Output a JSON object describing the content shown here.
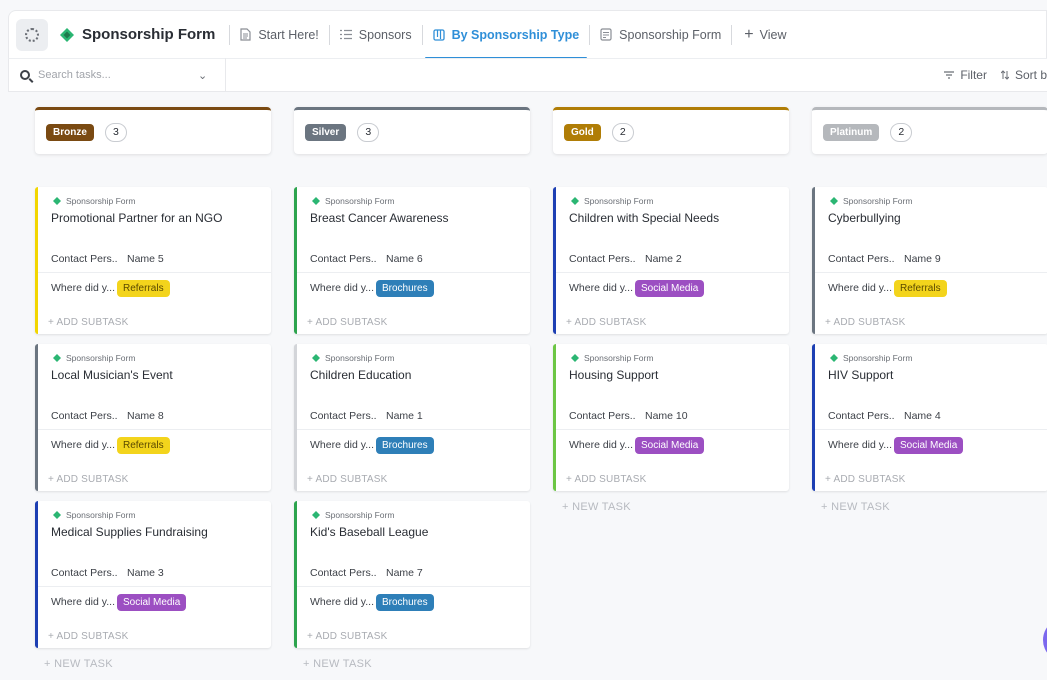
{
  "header": {
    "list_title": "Sponsorship Form",
    "tabs": [
      {
        "label": "Start Here!",
        "icon": "doc-icon"
      },
      {
        "label": "Sponsors",
        "icon": "list-icon"
      },
      {
        "label": "By Sponsorship Type",
        "icon": "board-icon",
        "active": true
      },
      {
        "label": "Sponsorship Form",
        "icon": "form-icon"
      }
    ],
    "add_view_label": "View"
  },
  "toolbar": {
    "search_placeholder": "Search tasks...",
    "filter_label": "Filter",
    "sort_label": "Sort b"
  },
  "colors": {
    "accent": "#2f8fd8",
    "bronze": "#7a4a12",
    "silver": "#6b7580",
    "gold": "#b07d06",
    "platinum": "#b5b8bc",
    "referrals_tag": "#f3d41c",
    "brochures_tag": "#2e7fb8",
    "social_media_tag": "#9c4fc2"
  },
  "board": {
    "card_source": "Sponsorship Form",
    "contact_label": "Contact Pers...",
    "where_label": "Where did y...",
    "add_subtask_label": "+ ADD SUBTASK",
    "new_task_label": "+ NEW TASK",
    "columns": [
      {
        "name": "Bronze",
        "count": "3",
        "cards": [
          {
            "title": "Promotional Partner for an NGO",
            "contact": "Name 5",
            "source": "Referrals"
          },
          {
            "title": "Local Musician's Event",
            "contact": "Name 8",
            "source": "Referrals"
          },
          {
            "title": "Medical Supplies Fundraising",
            "contact": "Name 3",
            "source": "Social Media"
          }
        ]
      },
      {
        "name": "Silver",
        "count": "3",
        "cards": [
          {
            "title": "Breast Cancer Awareness",
            "contact": "Name 6",
            "source": "Brochures"
          },
          {
            "title": "Children Education",
            "contact": "Name 1",
            "source": "Brochures"
          },
          {
            "title": "Kid's Baseball League",
            "contact": "Name 7",
            "source": "Brochures"
          }
        ]
      },
      {
        "name": "Gold",
        "count": "2",
        "cards": [
          {
            "title": "Children with Special Needs",
            "contact": "Name 2",
            "source": "Social Media"
          },
          {
            "title": "Housing Support",
            "contact": "Name 10",
            "source": "Social Media"
          }
        ]
      },
      {
        "name": "Platinum",
        "count": "2",
        "cards": [
          {
            "title": "Cyberbullying",
            "contact": "Name 9",
            "source": "Referrals"
          },
          {
            "title": "HIV Support",
            "contact": "Name 4",
            "source": "Social Media"
          }
        ]
      }
    ]
  }
}
